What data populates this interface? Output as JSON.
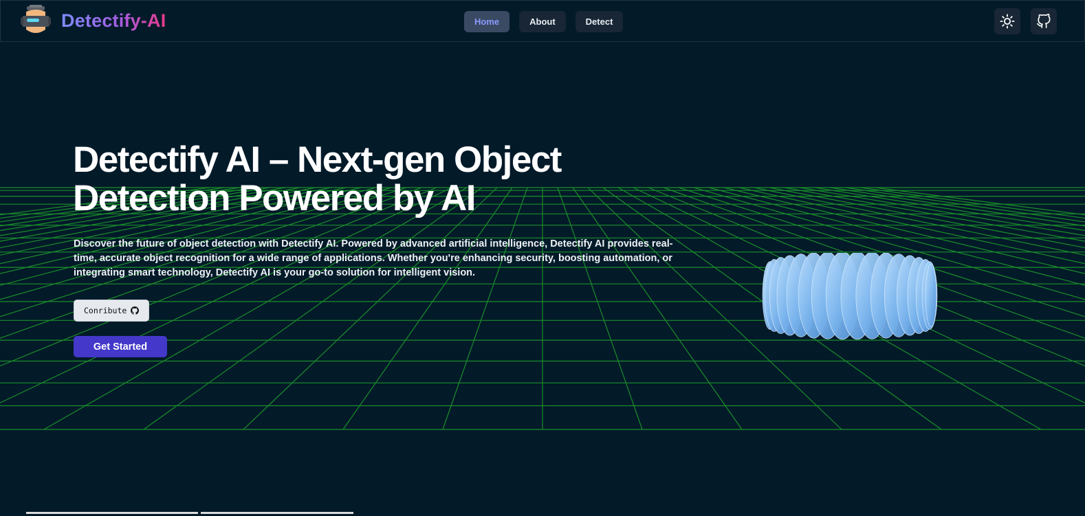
{
  "brand": {
    "name": "Detectify-AI",
    "logo": "robot-avatar-logo"
  },
  "nav": {
    "links": [
      {
        "label": "Home",
        "active": true
      },
      {
        "label": "About",
        "active": false
      },
      {
        "label": "Detect",
        "active": false
      }
    ],
    "icons": [
      "sun-icon",
      "github-icon"
    ]
  },
  "hero": {
    "title": "Detectify AI – Next-gen Object Detection Powered by AI",
    "description": "Discover the future of object detection with Detectify AI. Powered by advanced artificial intelligence, Detectify AI provides real-time, accurate object recognition for a wide range of applications. Whether you're enhancing security, boosting automation, or integrating smart technology, Detectify AI is your go-to solution for intelligent vision.",
    "contribute_label": "Conribute",
    "get_started_label": "Get Started"
  },
  "colors": {
    "background": "#031a29",
    "grid": "#1a8f2a",
    "primary_button": "#4338ca",
    "active_link_text": "#8b9bff",
    "object": "#7fbaf0"
  }
}
